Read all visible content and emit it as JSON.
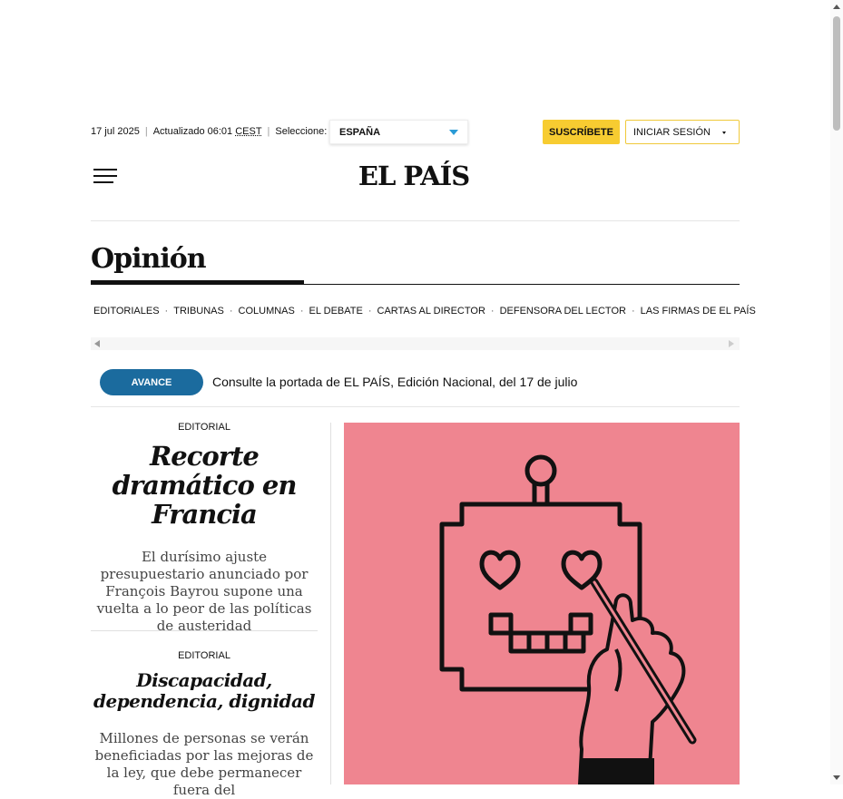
{
  "header": {
    "date": "17 jul 2025",
    "updated": "Actualizado 06:01",
    "timezone": "CEST",
    "select_label": "Seleccione:",
    "edition": "ESPAÑA",
    "subscribe_label": "SUSCRÍBETE",
    "login_label": "INICIAR SESIÓN",
    "logo": "EL PAÍS",
    "menu_icon": "hamburger-menu-icon"
  },
  "section": {
    "title": "Opinión",
    "nav": [
      "EDITORIALES",
      "TRIBUNAS",
      "COLUMNAS",
      "EL DEBATE",
      "CARTAS AL DIRECTOR",
      "DEFENSORA DEL LECTOR",
      "LAS FIRMAS DE EL PAÍS"
    ]
  },
  "avance": {
    "button_label": "AVANCE",
    "text": "Consulte la portada de EL PAÍS, Edición Nacional, del 17 de julio"
  },
  "articles": [
    {
      "kicker": "EDITORIAL",
      "headline": "Recorte dramático en Francia",
      "lead": "El durísimo ajuste presupuestario anunciado por François Bayrou supone una vuelta a lo peor de las políticas de austeridad"
    },
    {
      "kicker": "EDITORIAL",
      "headline": "Discapacidad, dependencia, dignidad",
      "lead": "Millones de personas se verán beneficiadas por las mejoras de la ley, que debe permanecer fuera del"
    }
  ],
  "colors": {
    "accent_yellow": "#f7cc31",
    "avance_blue": "#1b6b9e",
    "illustration_bg": "#ef8590",
    "caret_blue": "#2a9bd6"
  }
}
